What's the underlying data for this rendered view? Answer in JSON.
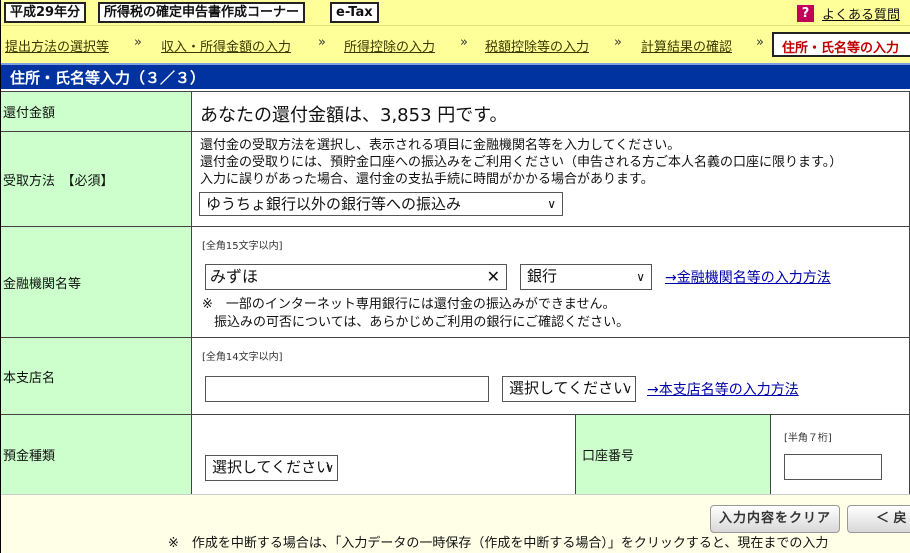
{
  "header": {
    "era": "平成29年分",
    "corner": "所得税の確定申告書作成コーナー",
    "etax": "e-Tax",
    "help_icon": "?",
    "faq": "よくある質問"
  },
  "breadcrumb": {
    "items": [
      "提出方法の選択等",
      "収入・所得金額の入力",
      "所得控除の入力",
      "税額控除等の入力",
      "計算結果の確認"
    ],
    "separator": "»",
    "current": "住所・氏名等の入力"
  },
  "page_title": "住所・氏名等入力（３／３）",
  "refund": {
    "label": "還付金額",
    "message": "あなたの還付金額は、3,853 円です。"
  },
  "receive": {
    "label": "受取方法　【必須】",
    "note1": "還付金の受取方法を選択し、表示される項目に金融機関名等を入力してください。",
    "note2": "還付金の受取りには、預貯金口座への振込みをご利用ください（申告される方ご本人名義の口座に限ります。）",
    "note3": "入力に誤りがあった場合、還付金の支払手続に時間がかかる場合があります。",
    "selected": "ゆうちょ銀行以外の銀行等への振込み"
  },
  "bank": {
    "label": "金融機関名等",
    "hint": "[全角15文字以内]",
    "value": "みずほ",
    "type_selected": "銀行",
    "link": "→金融機関名等の入力方法",
    "note1": "※　一部のインターネット専用銀行には還付金の振込みができません。",
    "note2": "振込みの可否については、あらかじめご利用の銀行にご確認ください。"
  },
  "branch": {
    "label": "本支店名",
    "hint": "[全角14文字以内]",
    "value": "",
    "type_selected": "選択してください",
    "link": "→本支店名等の入力方法"
  },
  "deposit": {
    "label": "預金種類",
    "selected": "選択してください"
  },
  "account": {
    "label": "口座番号",
    "hint": "[半角７桁]",
    "value": ""
  },
  "footer": {
    "clear_button": "入力内容をクリア",
    "back_button": "＜ 戻",
    "note": "※　作成を中断する場合は、「入力データの一時保存（作成を中断する場合）」をクリックすると、現在までの入力"
  }
}
